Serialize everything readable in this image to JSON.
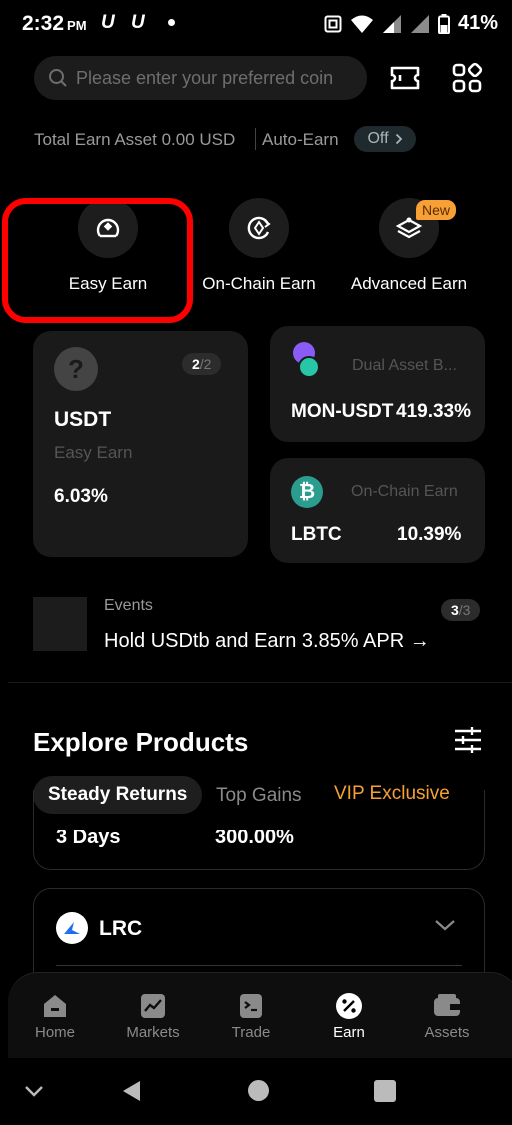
{
  "status": {
    "time": "2:32",
    "ampm": "PM",
    "u1": "U",
    "u2": "U",
    "battery": "41%"
  },
  "search": {
    "placeholder": "Please enter your preferred coin"
  },
  "earn_summary": {
    "total_text": "Total Earn Asset 0.00 USD",
    "auto_label": "Auto-Earn",
    "auto_state": "Off"
  },
  "categories": [
    {
      "label": "Easy Earn",
      "icon": "easy-earn-icon"
    },
    {
      "label": "On-Chain Earn",
      "icon": "on-chain-icon"
    },
    {
      "label": "Advanced Earn",
      "icon": "advanced-earn-icon",
      "badge": "New"
    }
  ],
  "featured": {
    "usdt": {
      "pager_current": "2",
      "pager_total": "/2",
      "coin": "USDT",
      "product": "Easy Earn",
      "rate": "6.03%"
    },
    "dual": {
      "product": "Dual Asset B...",
      "pair": "MON-USDT",
      "rate": "419.33%"
    },
    "onchain": {
      "product": "On-Chain Earn",
      "coin": "LBTC",
      "rate": "10.39%"
    }
  },
  "events": {
    "label": "Events",
    "title": "Hold USDtb and Earn 3.85% APR →",
    "pager_current": "3",
    "pager_total": "/3"
  },
  "explore": {
    "title": "Explore Products",
    "tabs": [
      "Steady Returns",
      "Top Gains",
      "VIP Exclusive"
    ],
    "row_partial": {
      "term": "3 Days",
      "rate": "300.00%"
    },
    "coin_card": {
      "coin": "LRC"
    }
  },
  "bottom_nav": [
    {
      "label": "Home",
      "icon": "home-icon"
    },
    {
      "label": "Markets",
      "icon": "markets-icon"
    },
    {
      "label": "Trade",
      "icon": "trade-icon"
    },
    {
      "label": "Earn",
      "icon": "earn-icon",
      "active": true
    },
    {
      "label": "Assets",
      "icon": "assets-icon"
    }
  ],
  "colors": {
    "accent_orange": "#f7a035",
    "highlight_red": "#ff0000",
    "background": "#000000",
    "card": "#1a1a1a"
  }
}
